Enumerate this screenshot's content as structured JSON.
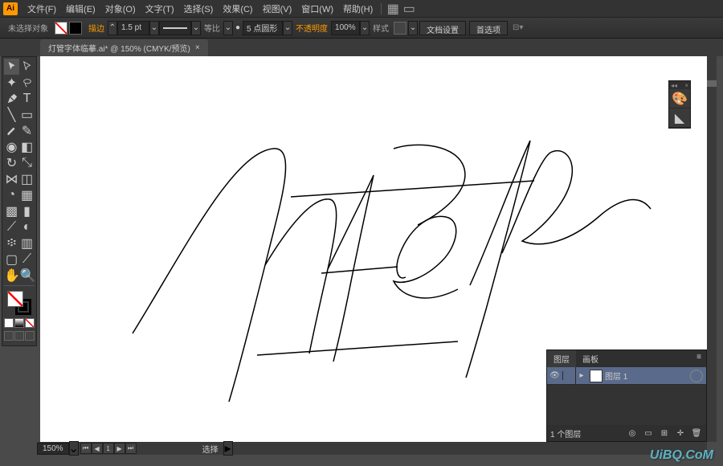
{
  "app": {
    "logo": "Ai"
  },
  "menu": {
    "items": [
      "文件(F)",
      "编辑(E)",
      "对象(O)",
      "文字(T)",
      "选择(S)",
      "效果(C)",
      "视图(V)",
      "窗口(W)",
      "帮助(H)"
    ]
  },
  "control": {
    "no_selection": "未选择对象",
    "stroke_label": "描边",
    "stroke_weight": "1.5 pt",
    "uniform": "等比",
    "profile_value": "5 点圆形",
    "opacity_label": "不透明度",
    "opacity_value": "100%",
    "style_label": "样式",
    "doc_setup": "文档设置",
    "prefs": "首选项"
  },
  "tab": {
    "title": "灯管字体临摹.ai* @ 150% (CMYK/预览)",
    "close": "×"
  },
  "status": {
    "zoom": "150%",
    "tool": "选择"
  },
  "layers": {
    "tab_layers": "图层",
    "tab_artboards": "画板",
    "row_name": "图层 1",
    "count": "1 个图层",
    "vis_icon": "👁"
  },
  "watermark": "UiBQ.CoM"
}
